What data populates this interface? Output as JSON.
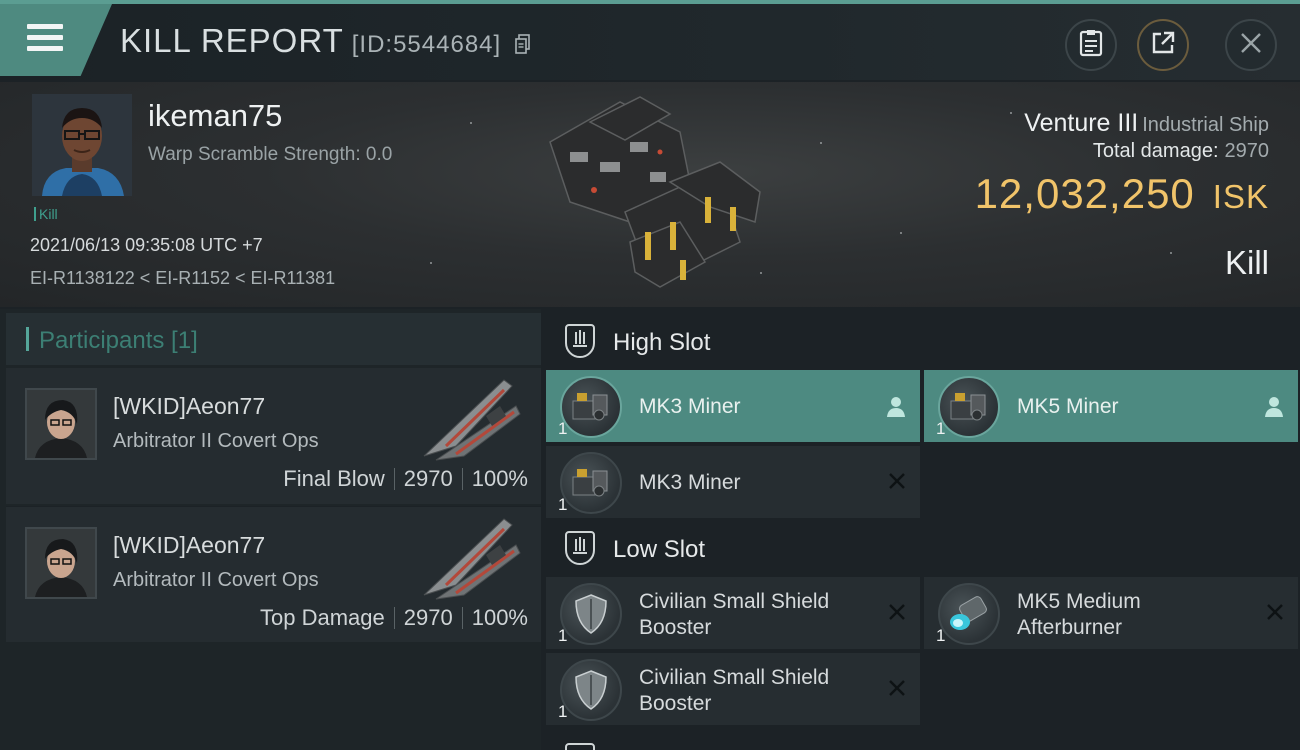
{
  "header": {
    "title": "KILL REPORT",
    "report_id": "[ID:5544684]",
    "buttons": [
      "clipboard-icon",
      "share-icon",
      "close-icon"
    ]
  },
  "victim": {
    "name": "ikeman75",
    "warp_scramble": "Warp Scramble Strength: 0.0",
    "tag": "Kill",
    "datetime": "2021/06/13 09:35:08 UTC +7",
    "route": "EI-R1138122 < EI-R1152 < EI-R11381",
    "ship_name": "Venture III",
    "ship_class": "Industrial Ship",
    "total_damage_label": "Total damage:",
    "total_damage": "2970",
    "isk_value": "12,032,250",
    "isk_unit": "ISK",
    "result": "Kill"
  },
  "participants": {
    "title": "Participants [1]",
    "rows": [
      {
        "name": "[WKID]Aeon77",
        "ship": "Arbitrator II Covert Ops",
        "role": "Final Blow",
        "damage": "2970",
        "percent": "100%"
      },
      {
        "name": "[WKID]Aeon77",
        "ship": "Arbitrator II Covert Ops",
        "role": "Top Damage",
        "damage": "2970",
        "percent": "100%"
      }
    ]
  },
  "slots": {
    "high": {
      "title": "High Slot",
      "modules": [
        {
          "name": "MK3 Miner",
          "qty": "1",
          "status": "dropped"
        },
        {
          "name": "MK5 Miner",
          "qty": "1",
          "status": "dropped"
        },
        {
          "name": "MK3 Miner",
          "qty": "1",
          "status": "destroyed"
        }
      ]
    },
    "low": {
      "title": "Low Slot",
      "modules": [
        {
          "name_line1": "Civilian Small Shield",
          "name_line2": "Booster",
          "qty": "1",
          "status": "destroyed"
        },
        {
          "name_line1": "MK5 Medium",
          "name_line2": "Afterburner",
          "qty": "1",
          "status": "destroyed"
        },
        {
          "name_line1": "Civilian Small Shield",
          "name_line2": "Booster",
          "qty": "1",
          "status": "destroyed"
        }
      ]
    }
  },
  "colors": {
    "accent": "#4d8a81",
    "isk_gold": "#f1c46a",
    "kill_green": "#3fa08e"
  }
}
